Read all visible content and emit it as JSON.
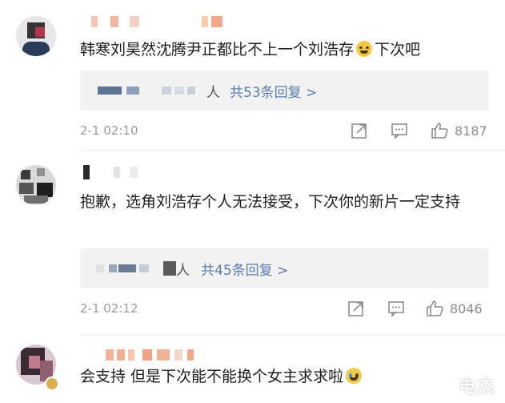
{
  "comments": [
    {
      "text_parts": [
        "韩寒刘昊然沈腾尹正都比不上一个刘浩存",
        "下次吧"
      ],
      "emoji": "laughing-tears-emoji",
      "reply_suffix": "人",
      "reply_link": "共53条回复 >",
      "time": "2-1 02:10",
      "likes": "8187"
    },
    {
      "text": "抱歉，选角刘浩存个人无法接受，下次你的新片一定支持",
      "reply_suffix": "人",
      "reply_link": "共45条回复 >",
      "time": "2-1 02:12",
      "likes": "8046"
    },
    {
      "text": "会支持 但是下次能不能换个女主求求啦",
      "emoji": "crying-emoji"
    }
  ],
  "icons": {
    "share": "share-icon",
    "reply": "comment-icon",
    "like": "thumbs-up-icon"
  },
  "colors": {
    "link": "#5a7dae",
    "meta": "#9a9a9a",
    "reply_bg": "#f2f2f2"
  },
  "watermark": "电杰"
}
